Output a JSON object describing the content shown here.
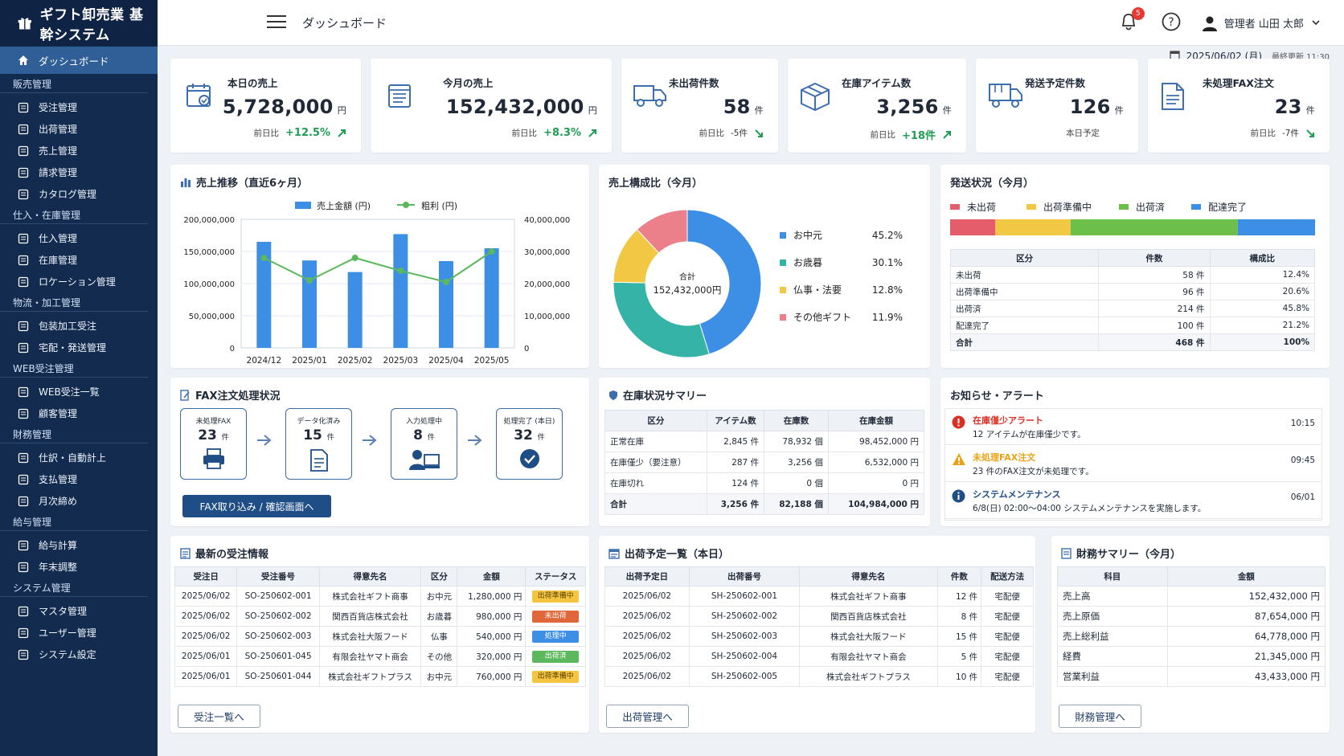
{
  "app": {
    "title": "ギフト卸売業 基幹システム"
  },
  "header": {
    "page_title": "ダッシュボード",
    "notif_count": "5",
    "user": "管理者 山田 太郎"
  },
  "date": {
    "current": "2025/06/02 (月)",
    "updated": "最終更新 11:30"
  },
  "sidebar": {
    "dashboard": "ダッシュボード",
    "groups": [
      {
        "label": "販売管理",
        "items": [
          "受注管理",
          "出荷管理",
          "売上管理",
          "請求管理",
          "カタログ管理"
        ]
      },
      {
        "label": "仕入・在庫管理",
        "items": [
          "仕入管理",
          "在庫管理",
          "ロケーション管理"
        ]
      },
      {
        "label": "物流・加工管理",
        "items": [
          "包装加工受注",
          "宅配・発送管理"
        ]
      },
      {
        "label": "WEB受注管理",
        "items": [
          "WEB受注一覧",
          "顧客管理"
        ]
      },
      {
        "label": "財務管理",
        "items": [
          "仕訳・自動計上",
          "支払管理",
          "月次締め"
        ]
      },
      {
        "label": "給与管理",
        "items": [
          "給与計算",
          "年末調整"
        ]
      },
      {
        "label": "システム管理",
        "items": [
          "マスタ管理",
          "ユーザー管理",
          "システム設定"
        ]
      }
    ]
  },
  "kpis": [
    {
      "label": "本日の売上",
      "value": "5,728,000",
      "unit": "円",
      "sub": "前日比",
      "delta": "+12.5%",
      "trend": "up"
    },
    {
      "label": "今月の売上",
      "value": "152,432,000",
      "unit": "円",
      "sub": "前日比",
      "delta": "+8.3%",
      "trend": "up"
    },
    {
      "label": "未出荷件数",
      "value": "58",
      "unit": "件",
      "sub": "前日比",
      "delta": "-5件",
      "trend": "down"
    },
    {
      "label": "在庫アイテム数",
      "value": "3,256",
      "unit": "件",
      "sub": "前日比",
      "delta": "+18件",
      "trend": "up"
    },
    {
      "label": "発送予定件数",
      "value": "126",
      "unit": "件",
      "sub": "本日予定",
      "delta": "",
      "trend": "none"
    },
    {
      "label": "未処理FAX注文",
      "value": "23",
      "unit": "件",
      "sub": "前日比",
      "delta": "-7件",
      "trend": "down"
    }
  ],
  "sales_trend": {
    "title": "売上推移（直近6ヶ月）",
    "legend_bar": "売上金額 (円)",
    "legend_line": "粗利 (円)",
    "left_ticks": [
      "200,000,000",
      "150,000,000",
      "100,000,000",
      "50,000,000",
      "0"
    ],
    "right_ticks": [
      "40,000,000",
      "30,000,000",
      "20,000,000",
      "10,000,000",
      "0"
    ]
  },
  "chart_data": [
    {
      "type": "bar",
      "title": "売上推移（直近6ヶ月）",
      "categories": [
        "2024/12",
        "2025/01",
        "2025/02",
        "2025/03",
        "2025/04",
        "2025/05"
      ],
      "series": [
        {
          "name": "売上金額 (円)",
          "axis": "left",
          "values": [
            165000000,
            136000000,
            118000000,
            177000000,
            135000000,
            155000000
          ]
        },
        {
          "name": "粗利 (円)",
          "type": "line",
          "axis": "right",
          "values": [
            28000000,
            21000000,
            28000000,
            24000000,
            20500000,
            30000000
          ]
        }
      ],
      "ylim": [
        0,
        200000000
      ],
      "y2lim": [
        0,
        40000000
      ],
      "colors": [
        "#3d8fe6",
        "#5cb85c"
      ]
    },
    {
      "type": "pie",
      "title": "売上構成比（今月）",
      "center_label": "合計",
      "center_value": "152,432,000円",
      "slices": [
        {
          "name": "お中元",
          "value": 45.2,
          "label": "45.2%",
          "color": "#3d8fe6"
        },
        {
          "name": "お歳暮",
          "value": 30.1,
          "label": "30.1%",
          "color": "#35b3a6"
        },
        {
          "name": "仏事・法要",
          "value": 12.8,
          "label": "12.8%",
          "color": "#f2c744"
        },
        {
          "name": "その他ギフト",
          "value": 11.9,
          "label": "11.9%",
          "color": "#eb7f8a"
        }
      ]
    },
    {
      "type": "bar",
      "title": "発送状況（今月）",
      "stacked": true,
      "series": [
        {
          "name": "未出荷",
          "value": 12.4,
          "color": "#e35d6a"
        },
        {
          "name": "出荷準備中",
          "value": 20.6,
          "color": "#f2c744"
        },
        {
          "name": "出荷済",
          "value": 45.8,
          "color": "#6cc04a"
        },
        {
          "name": "配達完了",
          "value": 21.2,
          "color": "#3d8fe6"
        }
      ]
    }
  ],
  "pie_title": "売上構成比（今月）",
  "ship": {
    "title": "発送状況（今月）",
    "headers": [
      "区分",
      "件数",
      "構成比"
    ],
    "rows": [
      [
        "未出荷",
        "58 件",
        "12.4%"
      ],
      [
        "出荷準備中",
        "96 件",
        "20.6%"
      ],
      [
        "出荷済",
        "214 件",
        "45.8%"
      ],
      [
        "配達完了",
        "100 件",
        "21.2%"
      ],
      [
        "合計",
        "468 件",
        "100%"
      ]
    ]
  },
  "fax": {
    "title": "FAX注文処理状況",
    "steps": [
      {
        "label": "未処理FAX",
        "value": "23",
        "unit": "件"
      },
      {
        "label": "データ化済み",
        "value": "15",
        "unit": "件"
      },
      {
        "label": "入力処理中",
        "value": "8",
        "unit": "件"
      },
      {
        "label": "処理完了 (本日)",
        "value": "32",
        "unit": "件"
      }
    ],
    "button": "FAX取り込み / 確認画面へ"
  },
  "stock": {
    "title": "在庫状況サマリー",
    "headers": [
      "区分",
      "アイテム数",
      "在庫数",
      "在庫金額"
    ],
    "rows": [
      [
        "正常在庫",
        "2,845 件",
        "78,932 個",
        "98,452,000 円"
      ],
      [
        "在庫僅少（要注意）",
        "287 件",
        "3,256 個",
        "6,532,000 円"
      ],
      [
        "在庫切れ",
        "124 件",
        "0 個",
        "0 円"
      ],
      [
        "合計",
        "3,256 件",
        "82,188 個",
        "104,984,000 円"
      ]
    ]
  },
  "alerts": {
    "title": "お知らせ・アラート",
    "items": [
      {
        "title": "在庫僅少アラート",
        "desc": "12 アイテムが在庫僅少です。",
        "time": "10:15",
        "type": "error"
      },
      {
        "title": "未処理FAX注文",
        "desc": "23 件のFAX注文が未処理です。",
        "time": "09:45",
        "type": "warning"
      },
      {
        "title": "システムメンテナンス",
        "desc": "6/8(日) 02:00〜04:00 システムメンテナンスを実施します。",
        "time": "06/01",
        "type": "info"
      }
    ]
  },
  "orders": {
    "title": "最新の受注情報",
    "headers": [
      "受注日",
      "受注番号",
      "得意先名",
      "区分",
      "金額",
      "ステータス"
    ],
    "rows": [
      [
        "2025/06/02",
        "SO-250602-001",
        "株式会社ギフト商事",
        "お中元",
        "1,280,000 円",
        "出荷準備中"
      ],
      [
        "2025/06/02",
        "SO-250602-002",
        "関西百貨店株式会社",
        "お歳暮",
        "980,000 円",
        "未出荷"
      ],
      [
        "2025/06/02",
        "SO-250602-003",
        "株式会社大阪フード",
        "仏事",
        "540,000 円",
        "処理中"
      ],
      [
        "2025/06/01",
        "SO-250601-045",
        "有限会社ヤマト商会",
        "その他",
        "320,000 円",
        "出荷済"
      ],
      [
        "2025/06/01",
        "SO-250601-044",
        "株式会社ギフトプラス",
        "お中元",
        "760,000 円",
        "出荷準備中"
      ]
    ],
    "status_colors": {
      "出荷準備中": "#f5c542",
      "未出荷": "#e0663b",
      "処理中": "#3d8fe6",
      "出荷済": "#5cb85c"
    },
    "button": "受注一覧へ"
  },
  "shipments": {
    "title": "出荷予定一覧（本日）",
    "headers": [
      "出荷予定日",
      "出荷番号",
      "得意先名",
      "件数",
      "配送方法"
    ],
    "rows": [
      [
        "2025/06/02",
        "SH-250602-001",
        "株式会社ギフト商事",
        "12 件",
        "宅配便"
      ],
      [
        "2025/06/02",
        "SH-250602-002",
        "関西百貨店株式会社",
        "8 件",
        "宅配便"
      ],
      [
        "2025/06/02",
        "SH-250602-003",
        "株式会社大阪フード",
        "15 件",
        "宅配便"
      ],
      [
        "2025/06/02",
        "SH-250602-004",
        "有限会社ヤマト商会",
        "5 件",
        "宅配便"
      ],
      [
        "2025/06/02",
        "SH-250602-005",
        "株式会社ギフトプラス",
        "10 件",
        "宅配便"
      ]
    ],
    "button": "出荷管理へ"
  },
  "finance": {
    "title": "財務サマリー（今月）",
    "headers": [
      "科目",
      "金額"
    ],
    "rows": [
      [
        "売上高",
        "152,432,000 円"
      ],
      [
        "売上原価",
        "87,654,000 円"
      ],
      [
        "売上総利益",
        "64,778,000 円"
      ],
      [
        "経費",
        "21,345,000 円"
      ],
      [
        "営業利益",
        "43,433,000 円"
      ]
    ],
    "button": "財務管理へ"
  }
}
